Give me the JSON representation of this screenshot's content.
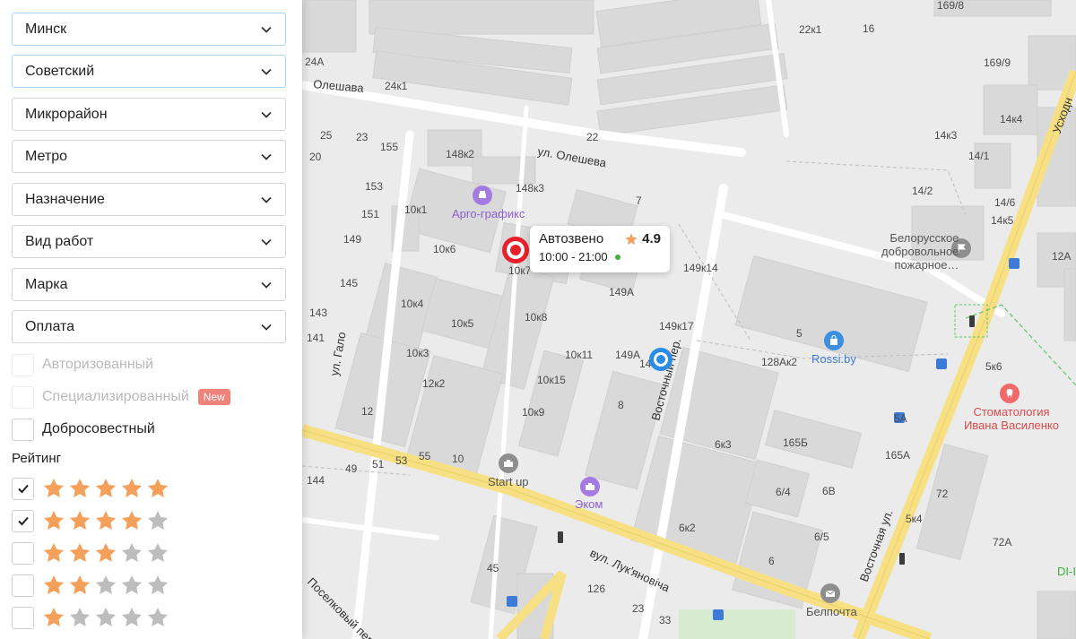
{
  "filters": {
    "city": "Минск",
    "district": "Советский",
    "microdistrict": "Микрорайон",
    "metro": "Метро",
    "purpose": "Назначение",
    "work_type": "Вид работ",
    "brand": "Марка",
    "payment": "Оплата"
  },
  "checks": {
    "authorized": "Авторизованный",
    "specialized": "Специализированный",
    "new_badge": "New",
    "honest": "Добросовестный"
  },
  "rating": {
    "title": "Рейтинг",
    "rows": [
      {
        "stars": 5,
        "checked": true
      },
      {
        "stars": 4,
        "checked": true
      },
      {
        "stars": 3,
        "checked": false
      },
      {
        "stars": 2,
        "checked": false
      },
      {
        "stars": 1,
        "checked": false
      }
    ],
    "star_color": "#f4a05b",
    "star_empty_color": "#bdbdbd"
  },
  "map": {
    "popup": {
      "name": "Автозвено",
      "rating": "4.9",
      "hours": "10:00 - 21:00"
    },
    "streets": {
      "olesheva_top": "Олешава",
      "olesheva": "ул. Олешева",
      "galo": "ул. Гало",
      "vostochny_per": "Восточный пер.",
      "vostochnaya": "Восточная ул.",
      "uskhodnyaya": "Усходн",
      "poselkovy": "Поселковый пер.",
      "lukyanovicha": "вул. Лук'яновіча"
    },
    "pois": {
      "argo": "Арго-графикс",
      "startup": "Start up",
      "ekom": "Эком",
      "rossi": "Rossi.by",
      "belpochta": "Белпочта",
      "fire1": "Белорусское",
      "fire2": "добровольное",
      "fire3": "пожарное…",
      "dent1": "Стоматология",
      "dent2": "Ивана Василенко",
      "di": "DI-I"
    },
    "houses": [
      "16",
      "169/8",
      "169/9",
      "22к1",
      "24А",
      "24к1",
      "14к4",
      "14к3",
      "14/1",
      "14/2",
      "14/6",
      "14к5",
      "148к2",
      "148к3",
      "10к1",
      "10к6",
      "10к7",
      "149к14",
      "149А",
      "149к17",
      "12А",
      "25",
      "23",
      "155",
      "20",
      "153",
      "151",
      "149",
      "22",
      "7",
      "145",
      "143",
      "141",
      "10к4",
      "10к5",
      "10к8",
      "10к3",
      "12к2",
      "12",
      "10",
      "10к15",
      "10к9",
      "10к11",
      "149А",
      "8",
      "5",
      "128Ак2",
      "5к6",
      "5А",
      "6к3",
      "165Б",
      "165А",
      "6/4",
      "6В",
      "6к2",
      "6/5",
      "6",
      "5к4",
      "72",
      "72А",
      "144",
      "49",
      "51",
      "53",
      "55",
      "45",
      "126",
      "23",
      "33",
      "14"
    ],
    "colors": {
      "accent_red": "#e8202b",
      "accent_blue": "#2b8ce8",
      "road_yellow": "#f7e084",
      "building": "#d9d9d9",
      "green": "#3bb33b"
    }
  }
}
